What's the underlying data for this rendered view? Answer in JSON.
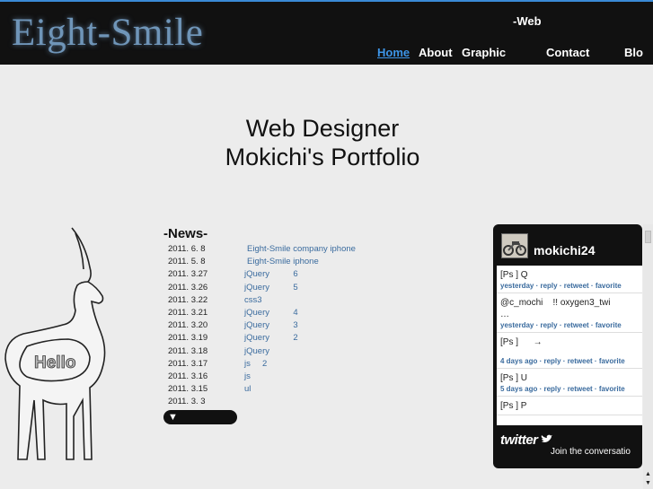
{
  "header": {
    "logo": "Eight-Smile",
    "tagline": "-Web",
    "nav": [
      {
        "label": "Home",
        "active": true
      },
      {
        "label": "About",
        "active": false
      },
      {
        "label": "Graphic",
        "active": false
      },
      {
        "label": "Contact",
        "active": false
      },
      {
        "label": "Blo",
        "active": false
      }
    ]
  },
  "hero": {
    "line1": "Web Designer",
    "line2": "Mokichi's Portfolio"
  },
  "illustration": {
    "label": "Hello"
  },
  "news": {
    "heading": "-News-",
    "items": [
      {
        "date": "2011. 6. 8",
        "text": "Eight-Smile company iphone"
      },
      {
        "date": "2011. 5. 8",
        "text": "Eight-Smile iphone"
      },
      {
        "date": "2011. 3.27",
        "text": "jQuery          6"
      },
      {
        "date": "2011. 3.26",
        "text": "jQuery          5"
      },
      {
        "date": "2011. 3.22",
        "text": "css3"
      },
      {
        "date": "2011. 3.21",
        "text": "jQuery          4"
      },
      {
        "date": "2011. 3.20",
        "text": "jQuery          3"
      },
      {
        "date": "2011. 3.19",
        "text": "jQuery          2"
      },
      {
        "date": "2011. 3.18",
        "text": "jQuery"
      },
      {
        "date": "2011. 3.17",
        "text": "js     2"
      },
      {
        "date": "2011. 3.16",
        "text": "js"
      },
      {
        "date": "2011. 3.15",
        "text": "ul"
      },
      {
        "date": "2011. 3. 3",
        "text": ""
      }
    ],
    "more_glyph": "▼"
  },
  "twitter": {
    "username": "mokichi24",
    "tweets": [
      {
        "text": "[Ps ] Q",
        "meta": "yesterday · reply · retweet · favorite"
      },
      {
        "text": "@c_mochi    !! oxygen3_twi           …",
        "meta": "yesterday · reply · retweet · favorite"
      },
      {
        "text": "[Ps ]      →",
        "meta": "4 days ago · reply · retweet · favorite"
      },
      {
        "text": "[Ps ] U",
        "meta": "5 days ago · reply · retweet · favorite"
      },
      {
        "text": "[Ps ] P",
        "meta": ""
      }
    ],
    "logo_text": "twitter",
    "join_text": "Join the conversatio"
  },
  "scrollbar": {
    "up_glyph": "▲",
    "down_glyph": "▼"
  }
}
